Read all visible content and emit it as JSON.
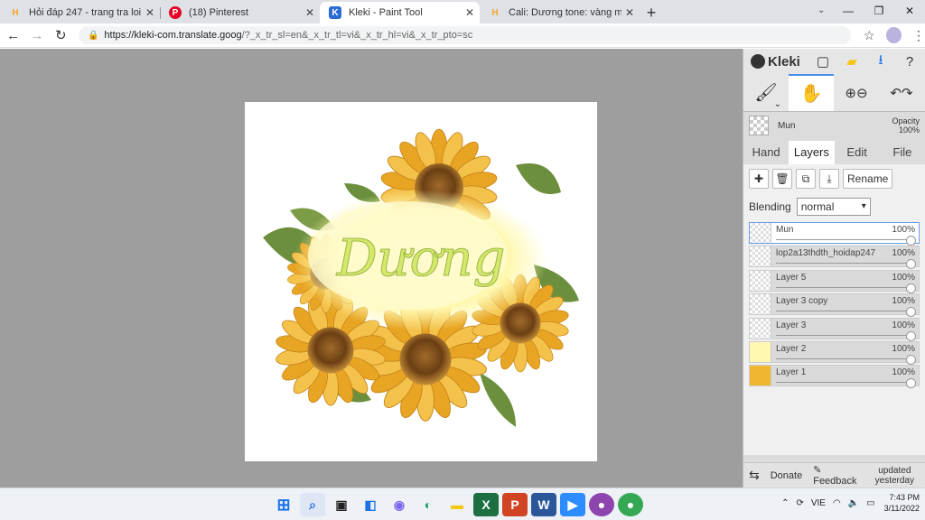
{
  "browser": {
    "tabs": [
      {
        "title": "Hỏi đáp 247 - trang tra loi",
        "fav": "H",
        "fav_color": "#f5a623",
        "active": false
      },
      {
        "title": "(18) Pinterest",
        "fav": "P",
        "fav_color": "#e60023",
        "active": false
      },
      {
        "title": "Kleki - Paint Tool",
        "fav": "K",
        "fav_color": "#2a6bd4",
        "active": true
      },
      {
        "title": "Cali: Dương tone: vàng mix xanh",
        "fav": "H",
        "fav_color": "#f5a623",
        "active": false
      }
    ],
    "new_tab": "+",
    "url_main": "https://kleki-com.translate.goog",
    "url_rest": "/?_x_tr_sl=en&_x_tr_tl=vi&_x_tr_hl=vi&_x_tr_pto=sc"
  },
  "kleki": {
    "logo": "Kleki",
    "brush_name": "Mun",
    "opacity_label": "Opacity",
    "opacity_value": "100%",
    "tabs": [
      "Hand",
      "Layers",
      "Edit",
      "File"
    ],
    "active_tab": "Layers",
    "rename": "Rename",
    "blending_label": "Blending",
    "blending_value": "normal",
    "layers": [
      {
        "name": "Mun",
        "opacity": "100%",
        "selected": true
      },
      {
        "name": "lop2a13thdth_hoidap247",
        "opacity": "100%",
        "selected": false
      },
      {
        "name": "Layer 5",
        "opacity": "100%",
        "selected": false
      },
      {
        "name": "Layer 3 copy",
        "opacity": "100%",
        "selected": false
      },
      {
        "name": "Layer 3",
        "opacity": "100%",
        "selected": false
      },
      {
        "name": "Layer 2",
        "opacity": "100%",
        "selected": false
      },
      {
        "name": "Layer 1",
        "opacity": "100%",
        "selected": false
      }
    ],
    "footer": {
      "donate": "Donate",
      "feedback": "Feedback",
      "updated_line1": "updated",
      "updated_line2": "yesterday"
    }
  },
  "artwork": {
    "text": "Dương"
  },
  "taskbar": {
    "lang": "VIE",
    "time": "7:43 PM",
    "date": "3/11/2022"
  }
}
